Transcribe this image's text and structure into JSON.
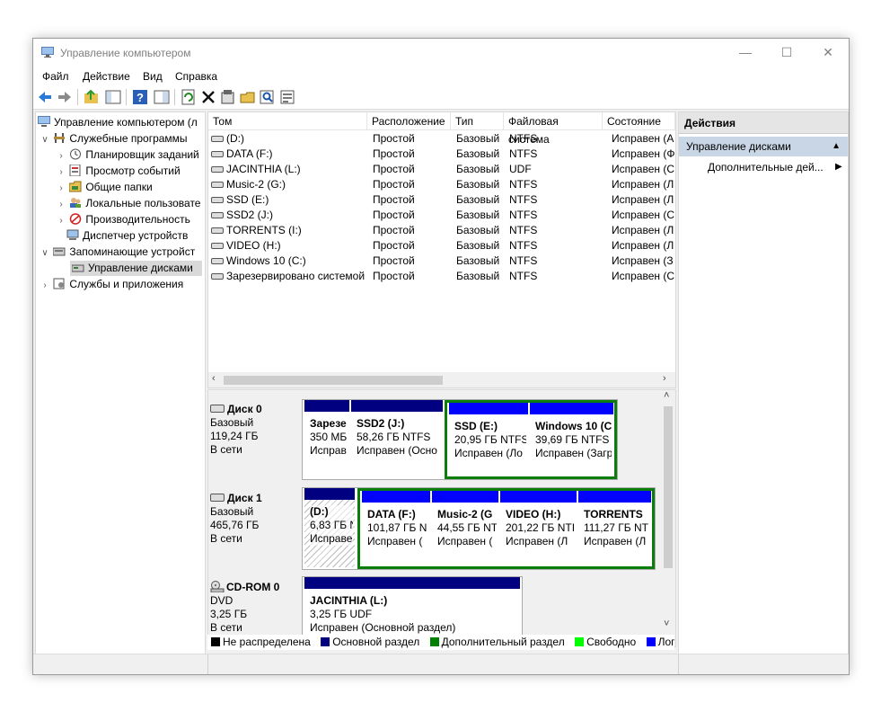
{
  "window": {
    "title": "Управление компьютером",
    "controls": {
      "minimize": "—",
      "maximize": "☐",
      "close": "✕"
    }
  },
  "menu": [
    "Файл",
    "Действие",
    "Вид",
    "Справка"
  ],
  "toolbar": [
    "back-icon",
    "forward-icon",
    "up-folder-icon",
    "show-tree-icon",
    "help-icon",
    "properties-pane-icon",
    "refresh-icon",
    "delete-icon",
    "properties-icon",
    "open-icon",
    "search-icon",
    "export-icon"
  ],
  "tree": {
    "root": "Управление компьютером (л",
    "items": [
      {
        "label": "Служебные программы",
        "icon": "tools-icon"
      },
      {
        "label": "Планировщик заданий",
        "icon": "clock-icon"
      },
      {
        "label": "Просмотр событий",
        "icon": "event-viewer-icon"
      },
      {
        "label": "Общие папки",
        "icon": "shared-folder-icon"
      },
      {
        "label": "Локальные пользовате",
        "icon": "users-icon"
      },
      {
        "label": "Производительность",
        "icon": "performance-icon"
      },
      {
        "label": "Диспетчер устройств",
        "icon": "device-manager-icon"
      },
      {
        "label": "Запоминающие устройст",
        "icon": "storage-icon"
      },
      {
        "label": "Управление дисками",
        "icon": "disk-management-icon"
      },
      {
        "label": "Службы и приложения",
        "icon": "services-icon"
      }
    ]
  },
  "volumes": {
    "columns": [
      "Том",
      "Расположение",
      "Тип",
      "Файловая система",
      "Состояние"
    ],
    "rows": [
      [
        "(D:)",
        "Простой",
        "Базовый",
        "NTFS",
        "Исправен (А"
      ],
      [
        "DATA (F:)",
        "Простой",
        "Базовый",
        "NTFS",
        "Исправен (Ф"
      ],
      [
        "JACINTHIA (L:)",
        "Простой",
        "Базовый",
        "UDF",
        "Исправен (С"
      ],
      [
        "Music-2 (G:)",
        "Простой",
        "Базовый",
        "NTFS",
        "Исправен (Л"
      ],
      [
        "SSD (E:)",
        "Простой",
        "Базовый",
        "NTFS",
        "Исправен (Л"
      ],
      [
        "SSD2 (J:)",
        "Простой",
        "Базовый",
        "NTFS",
        "Исправен (С"
      ],
      [
        "TORRENTS (I:)",
        "Простой",
        "Базовый",
        "NTFS",
        "Исправен (Л"
      ],
      [
        "VIDEO (H:)",
        "Простой",
        "Базовый",
        "NTFS",
        "Исправен (Л"
      ],
      [
        "Windows 10 (C:)",
        "Простой",
        "Базовый",
        "NTFS",
        "Исправен (З"
      ],
      [
        "Зарезервировано системой",
        "Простой",
        "Базовый",
        "NTFS",
        "Исправен (С"
      ]
    ]
  },
  "disks": [
    {
      "name": "Диск 0",
      "type": "Базовый",
      "size": "119,24 ГБ",
      "status": "В сети",
      "partitions": [
        {
          "name": "Зарезе",
          "size": "350 МБ",
          "status": "Исправ"
        },
        {
          "name": "SSD2  (J:)",
          "size": "58,26 ГБ NTFS",
          "status": "Исправен (Осно"
        },
        {
          "name": "SSD  (E:)",
          "size": "20,95 ГБ NTFS",
          "status": "Исправен (Ло"
        },
        {
          "name": "Windows 10  (С",
          "size": "39,69 ГБ NTFS",
          "status": "Исправен (Загр"
        }
      ]
    },
    {
      "name": "Диск 1",
      "type": "Базовый",
      "size": "465,76 ГБ",
      "status": "В сети",
      "partitions": [
        {
          "name": "(D:)",
          "size": "6,83 ГБ N",
          "status": "Исправе"
        },
        {
          "name": "DATA  (F:)",
          "size": "101,87 ГБ N",
          "status": "Исправен ("
        },
        {
          "name": "Music-2  (G",
          "size": "44,55 ГБ NT",
          "status": "Исправен ("
        },
        {
          "name": "VIDEO  (H:)",
          "size": "201,22 ГБ NTI",
          "status": "Исправен (Л"
        },
        {
          "name": "TORRENTS",
          "size": "111,27 ГБ NT",
          "status": "Исправен (Л"
        }
      ]
    },
    {
      "name": "CD-ROM 0",
      "type": "DVD",
      "size": "3,25 ГБ",
      "status": "В сети",
      "partitions": [
        {
          "name": "JACINTHIA  (L:)",
          "size": "3,25 ГБ UDF",
          "status": "Исправен (Основной раздел)"
        }
      ]
    }
  ],
  "legend": [
    {
      "label": "Не распределена",
      "color": "#000000"
    },
    {
      "label": "Основной раздел",
      "color": "#000080"
    },
    {
      "label": "Дополнительный раздел",
      "color": "#008000"
    },
    {
      "label": "Свободно",
      "color": "#00ff00"
    },
    {
      "label": "Логи",
      "color": "#0000ff"
    }
  ],
  "actions": {
    "header": "Действия",
    "section": "Управление дисками",
    "item": "Дополнительные дей..."
  }
}
